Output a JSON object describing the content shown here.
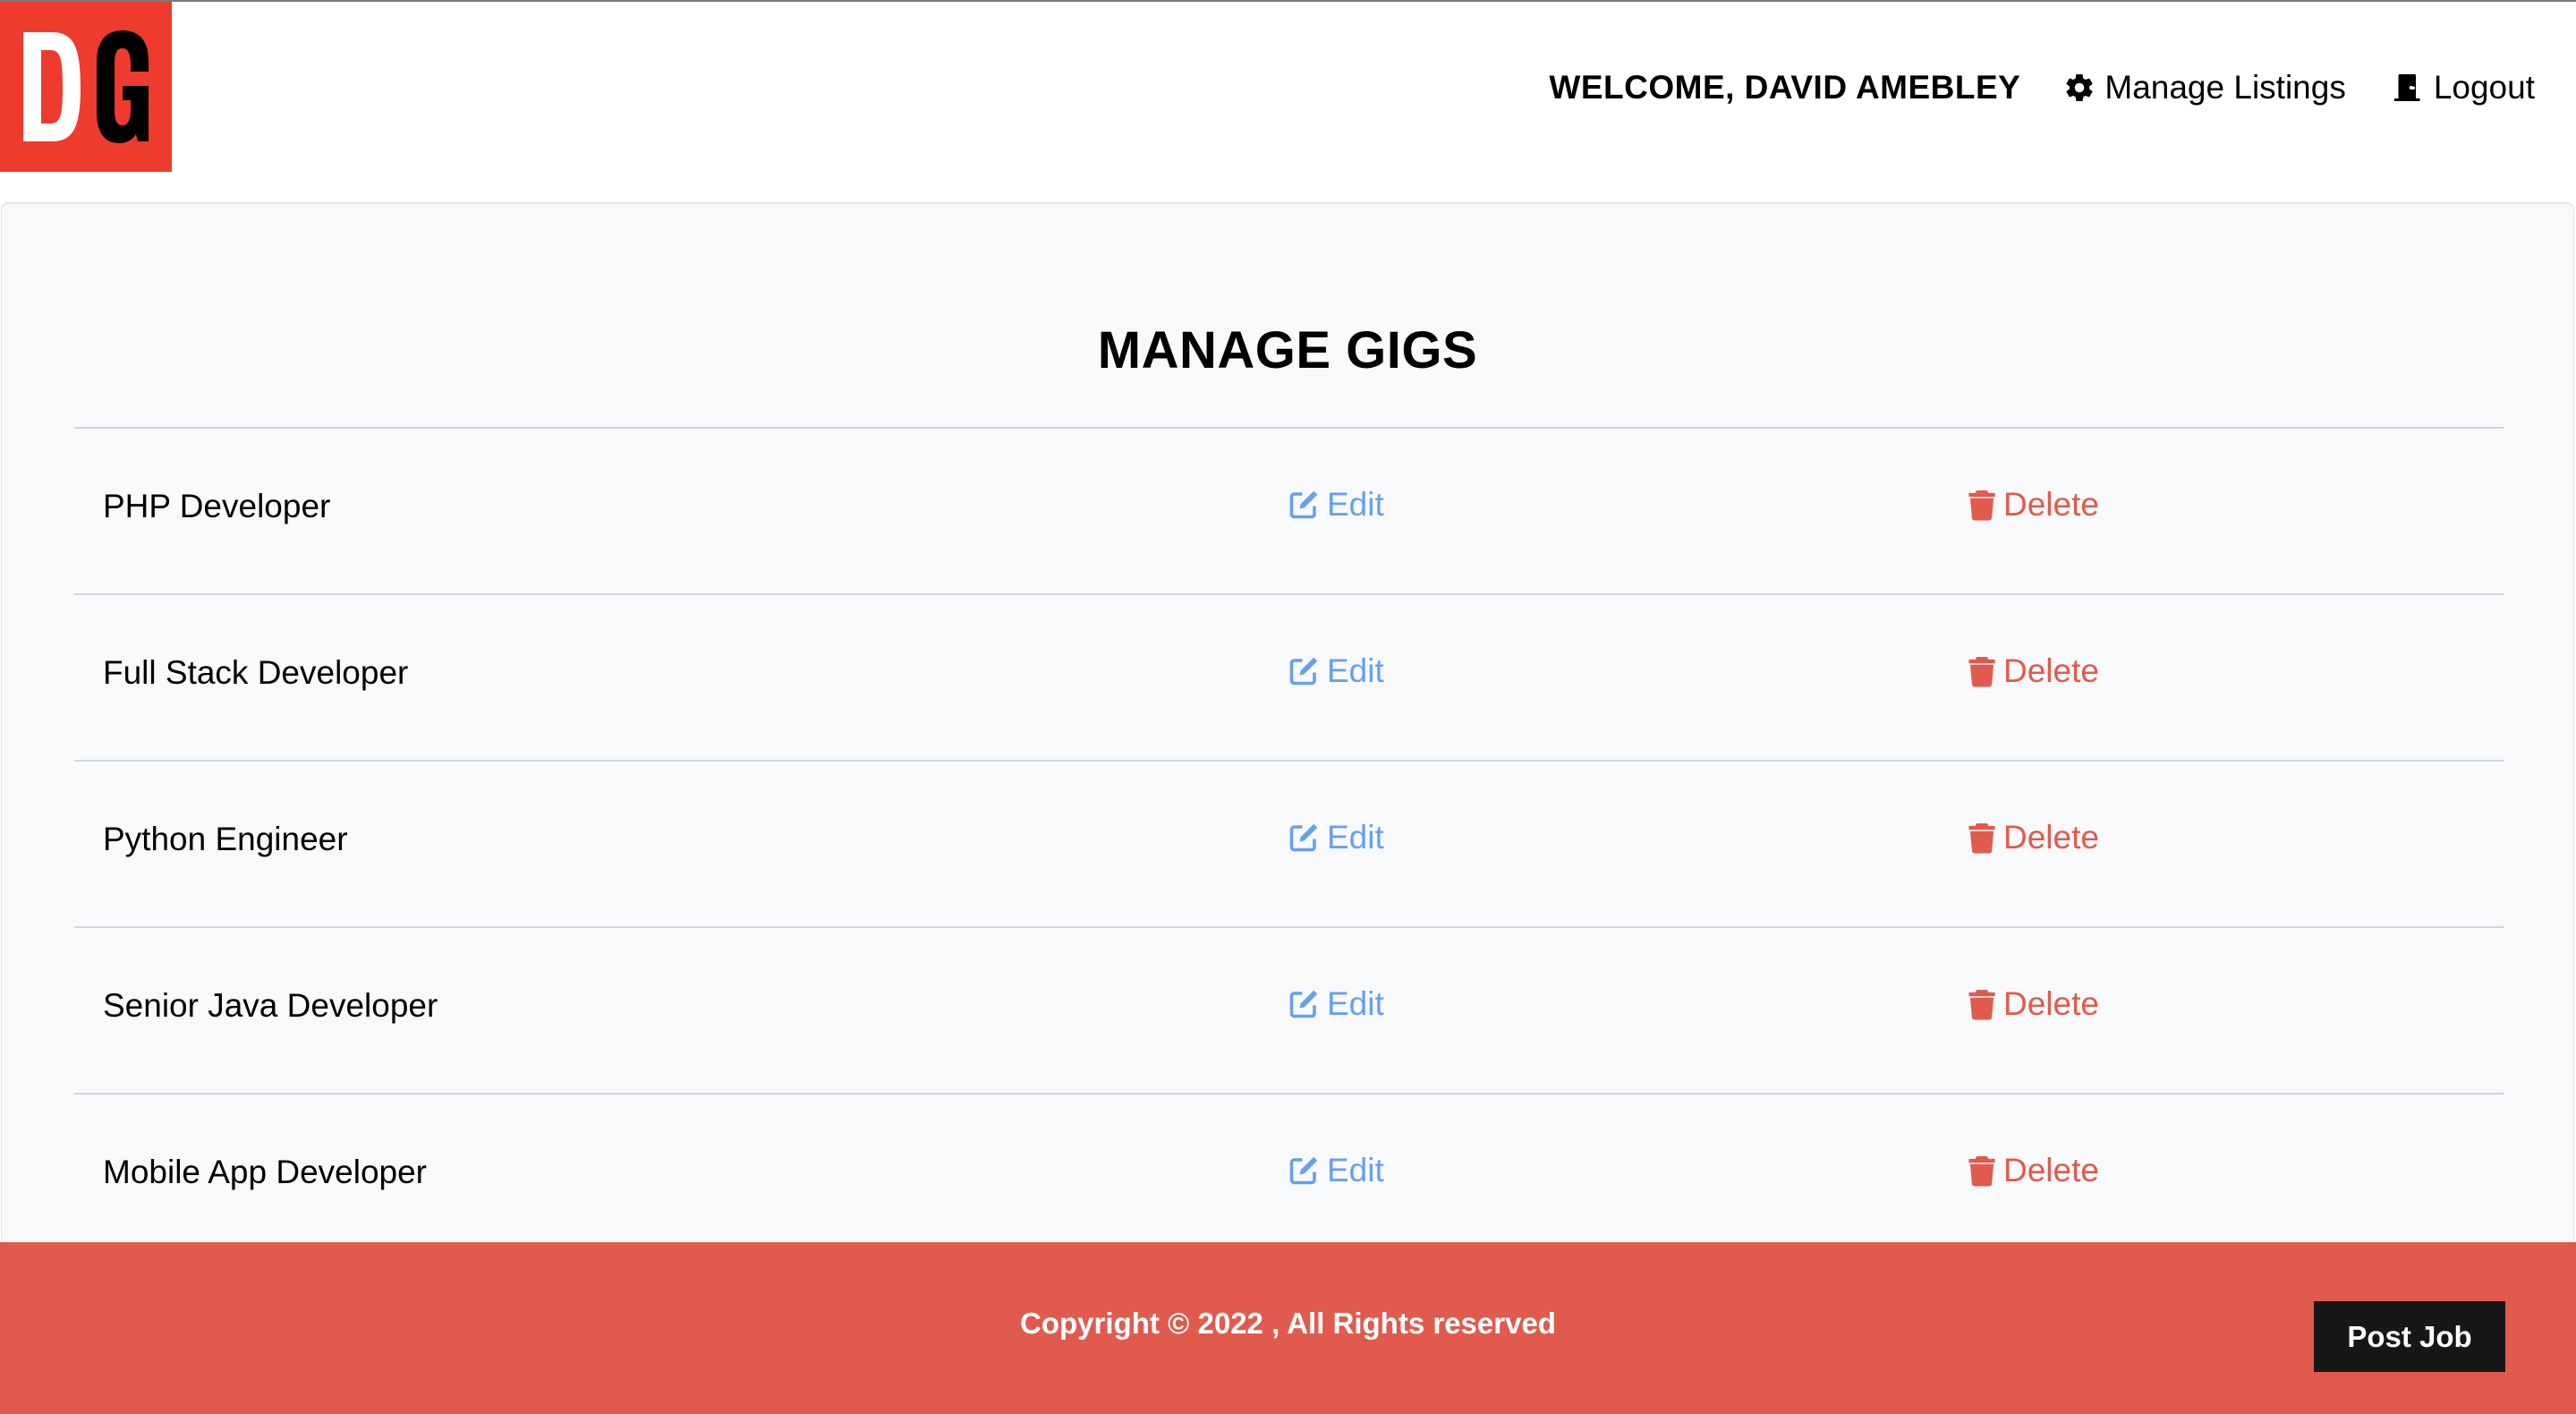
{
  "brand": {
    "logo_text": "DG",
    "logo_color": "#ef3b2d"
  },
  "header": {
    "welcome": "WELCOME, DAVID AMEBLEY",
    "nav": {
      "manage_listings": {
        "label": "Manage Listings",
        "icon": "gear-icon"
      },
      "logout": {
        "label": "Logout",
        "icon": "door-icon"
      }
    }
  },
  "main": {
    "title": "MANAGE GIGS",
    "gigs": [
      {
        "title": "PHP Developer",
        "edit_label": "Edit",
        "delete_label": "Delete"
      },
      {
        "title": "Full Stack Developer",
        "edit_label": "Edit",
        "delete_label": "Delete"
      },
      {
        "title": "Python Engineer",
        "edit_label": "Edit",
        "delete_label": "Delete"
      },
      {
        "title": "Senior Java Developer",
        "edit_label": "Edit",
        "delete_label": "Delete"
      },
      {
        "title": "Mobile App Developer",
        "edit_label": "Edit",
        "delete_label": "Delete"
      }
    ],
    "edit_icon": "edit-icon",
    "delete_icon": "trash-icon",
    "colors": {
      "edit": "#66a0ec",
      "delete": "#e05a4e"
    }
  },
  "footer": {
    "copyright": "Copyright © 2022 , All Rights reserved",
    "post_job_label": "Post Job",
    "background": "#e05b4d"
  }
}
